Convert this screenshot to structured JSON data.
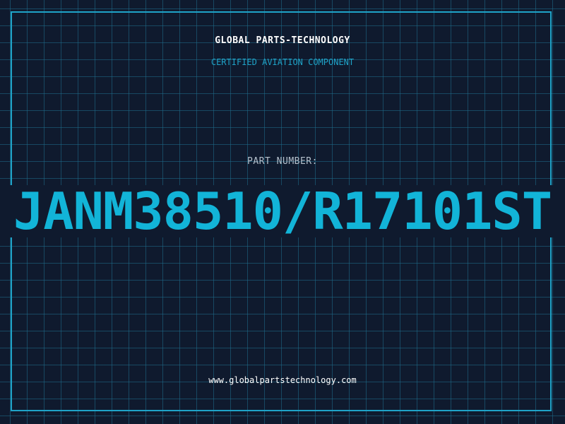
{
  "header": {
    "company": "GLOBAL PARTS-TECHNOLOGY",
    "tagline": "CERTIFIED AVIATION COMPONENT"
  },
  "part": {
    "label": "PART NUMBER:",
    "number": "JANM38510/R17101ST"
  },
  "footer": {
    "website": "www.globalpartstechnology.com"
  },
  "colors": {
    "background": "#0f1a2e",
    "grid": "#1e6e8c",
    "accent": "#12b4d8",
    "text": "#ffffff",
    "muted": "#b4c0cc"
  }
}
